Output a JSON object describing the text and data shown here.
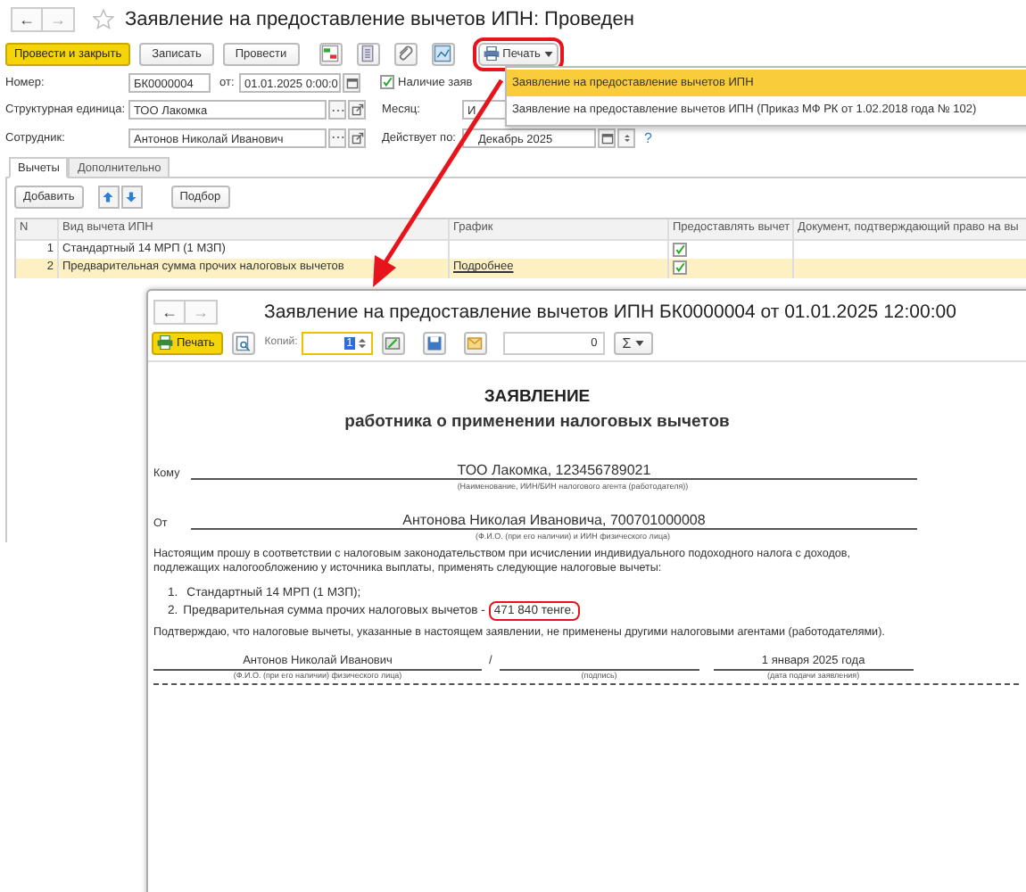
{
  "window": {
    "title": "Заявление на предоставление вычетов ИПН: Проведен",
    "nav": [
      "←",
      "→"
    ]
  },
  "toolbar": {
    "buttons": [
      {
        "label": "Провести и закрыть",
        "kind": "primary"
      },
      {
        "label": "Записать",
        "kind": "plain"
      },
      {
        "label": "Провести",
        "kind": "plain"
      }
    ],
    "print_button": {
      "label": "Печать",
      "highlighted": true
    }
  },
  "print_menu": {
    "items": [
      {
        "label": "Заявление на предоставление вычетов ИПН",
        "selected": true
      },
      {
        "label": "Заявление на предоставление вычетов ИПН (Приказ МФ РК от 1.02.2018 года № 102)",
        "selected": false
      }
    ]
  },
  "form": {
    "number": {
      "label": "Номер:",
      "value": "БК0000004"
    },
    "date": {
      "label": "от:",
      "value": "01.01.2025 0:00:0"
    },
    "application": {
      "label": "Наличие заяв",
      "checked": true
    },
    "unit": {
      "label": "Структурная единица:",
      "value": "ТОО Лакомка"
    },
    "month": {
      "label": "Месяц:",
      "value": "И"
    },
    "employee": {
      "label": "Сотрудник:",
      "value": "Антонов Николай Иванович"
    },
    "valid_until": {
      "label": "Действует по:",
      "value": "Декабрь 2025",
      "help": "?"
    }
  },
  "tabs": [
    {
      "label": "Вычеты",
      "selected": true
    },
    {
      "label": "Дополнительно",
      "selected": false
    }
  ],
  "table_buttons": {
    "add": "Добавить",
    "pick": "Подбор"
  },
  "table": {
    "columns": [
      "N",
      "Вид вычета ИПН",
      "График",
      "Предоставлять вычет",
      "Документ, подтверждающий право на вы"
    ],
    "rows": [
      {
        "n": "1",
        "type": "Стандартный 14 МРП (1 МЗП)",
        "apply": true,
        "selected": false
      },
      {
        "n": "2",
        "type": "Предварительная сумма прочих налоговых вычетов",
        "schedule": "Подробнее",
        "apply": true,
        "selected": true
      }
    ]
  },
  "print_window": {
    "title": "Заявление на предоставление вычетов ИПН БК0000004 от 01.01.2025 12:00:00",
    "nav": [
      "←",
      "→"
    ],
    "print_label": "Печать",
    "copies_label": "Копий:",
    "copies": "1",
    "counter": "0",
    "sum_symbol": "Σ",
    "document": {
      "heading": "ЗАЯВЛЕНИЕ",
      "subheading": "работника о применении налоговых вычетов",
      "to": {
        "label": "Кому",
        "value": "ТОО Лакомка, 123456789021",
        "caption": "(Наименование, ИИН/БИН налогового агента (работодателя))"
      },
      "from": {
        "label": "От",
        "value": "Антонова Николая Ивановича, 700701000008",
        "caption": "(Ф.И.О. (при его наличии) и ИИН физического лица)"
      },
      "request": "Настоящим прошу в соответствии с налоговым законодательством при исчислении индивидуального подоходного налога с доходов, подлежащих налогообложению у источника выплаты, применять следующие налоговые вычеты:",
      "deductions": [
        {
          "number": "1.",
          "text": "Стандартный 14 МРП (1 МЗП);",
          "highlighted": false
        },
        {
          "number": "2.",
          "text": "Предварительная сумма прочих налоговых вычетов -",
          "amount": "471 840 тенге.",
          "highlighted": true
        }
      ],
      "confirmation": "Подтверждаю, что налоговые вычеты, указанные в настоящем заявлении, не применены другими налоговыми агентами (работодателями).",
      "separator": "/",
      "signature": [
        {
          "value": "Антонов Николай Иванович",
          "caption": "(Ф.И.О. (при его наличии) физического лица)"
        },
        {
          "caption": "(подпись)"
        },
        {
          "value": "1 января 2025 года",
          "caption": "(дата подачи заявления)"
        }
      ]
    }
  }
}
